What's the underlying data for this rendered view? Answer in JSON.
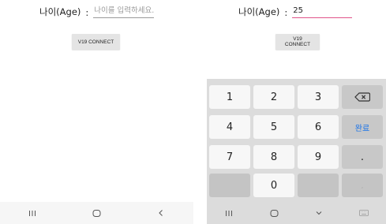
{
  "left": {
    "age_label": "나이(Age)",
    "colon": ":",
    "age_placeholder": "나이를 입력하세요.",
    "connect_label": "V19 CONNECT"
  },
  "right": {
    "age_label": "나이(Age)",
    "colon": ":",
    "age_value": "25",
    "connect_label": "V19 CONNECT",
    "keys": {
      "k1": "1",
      "k2": "2",
      "k3": "3",
      "k4": "4",
      "k5": "5",
      "k6": "6",
      "done": "완료",
      "k7": "7",
      "k8": "8",
      "k9": "9",
      "dot": ".",
      "k0": "0",
      "comma": ","
    }
  },
  "icons": {
    "recent": "recent-apps-icon",
    "home": "home-icon",
    "back": "back-icon",
    "backspace": "backspace-icon",
    "keyboard_hide": "keyboard-hide-icon",
    "keyboard_switch": "keyboard-switch-icon"
  },
  "colors": {
    "input_focus": "#e0548a",
    "done_key": "#1a73e8"
  }
}
